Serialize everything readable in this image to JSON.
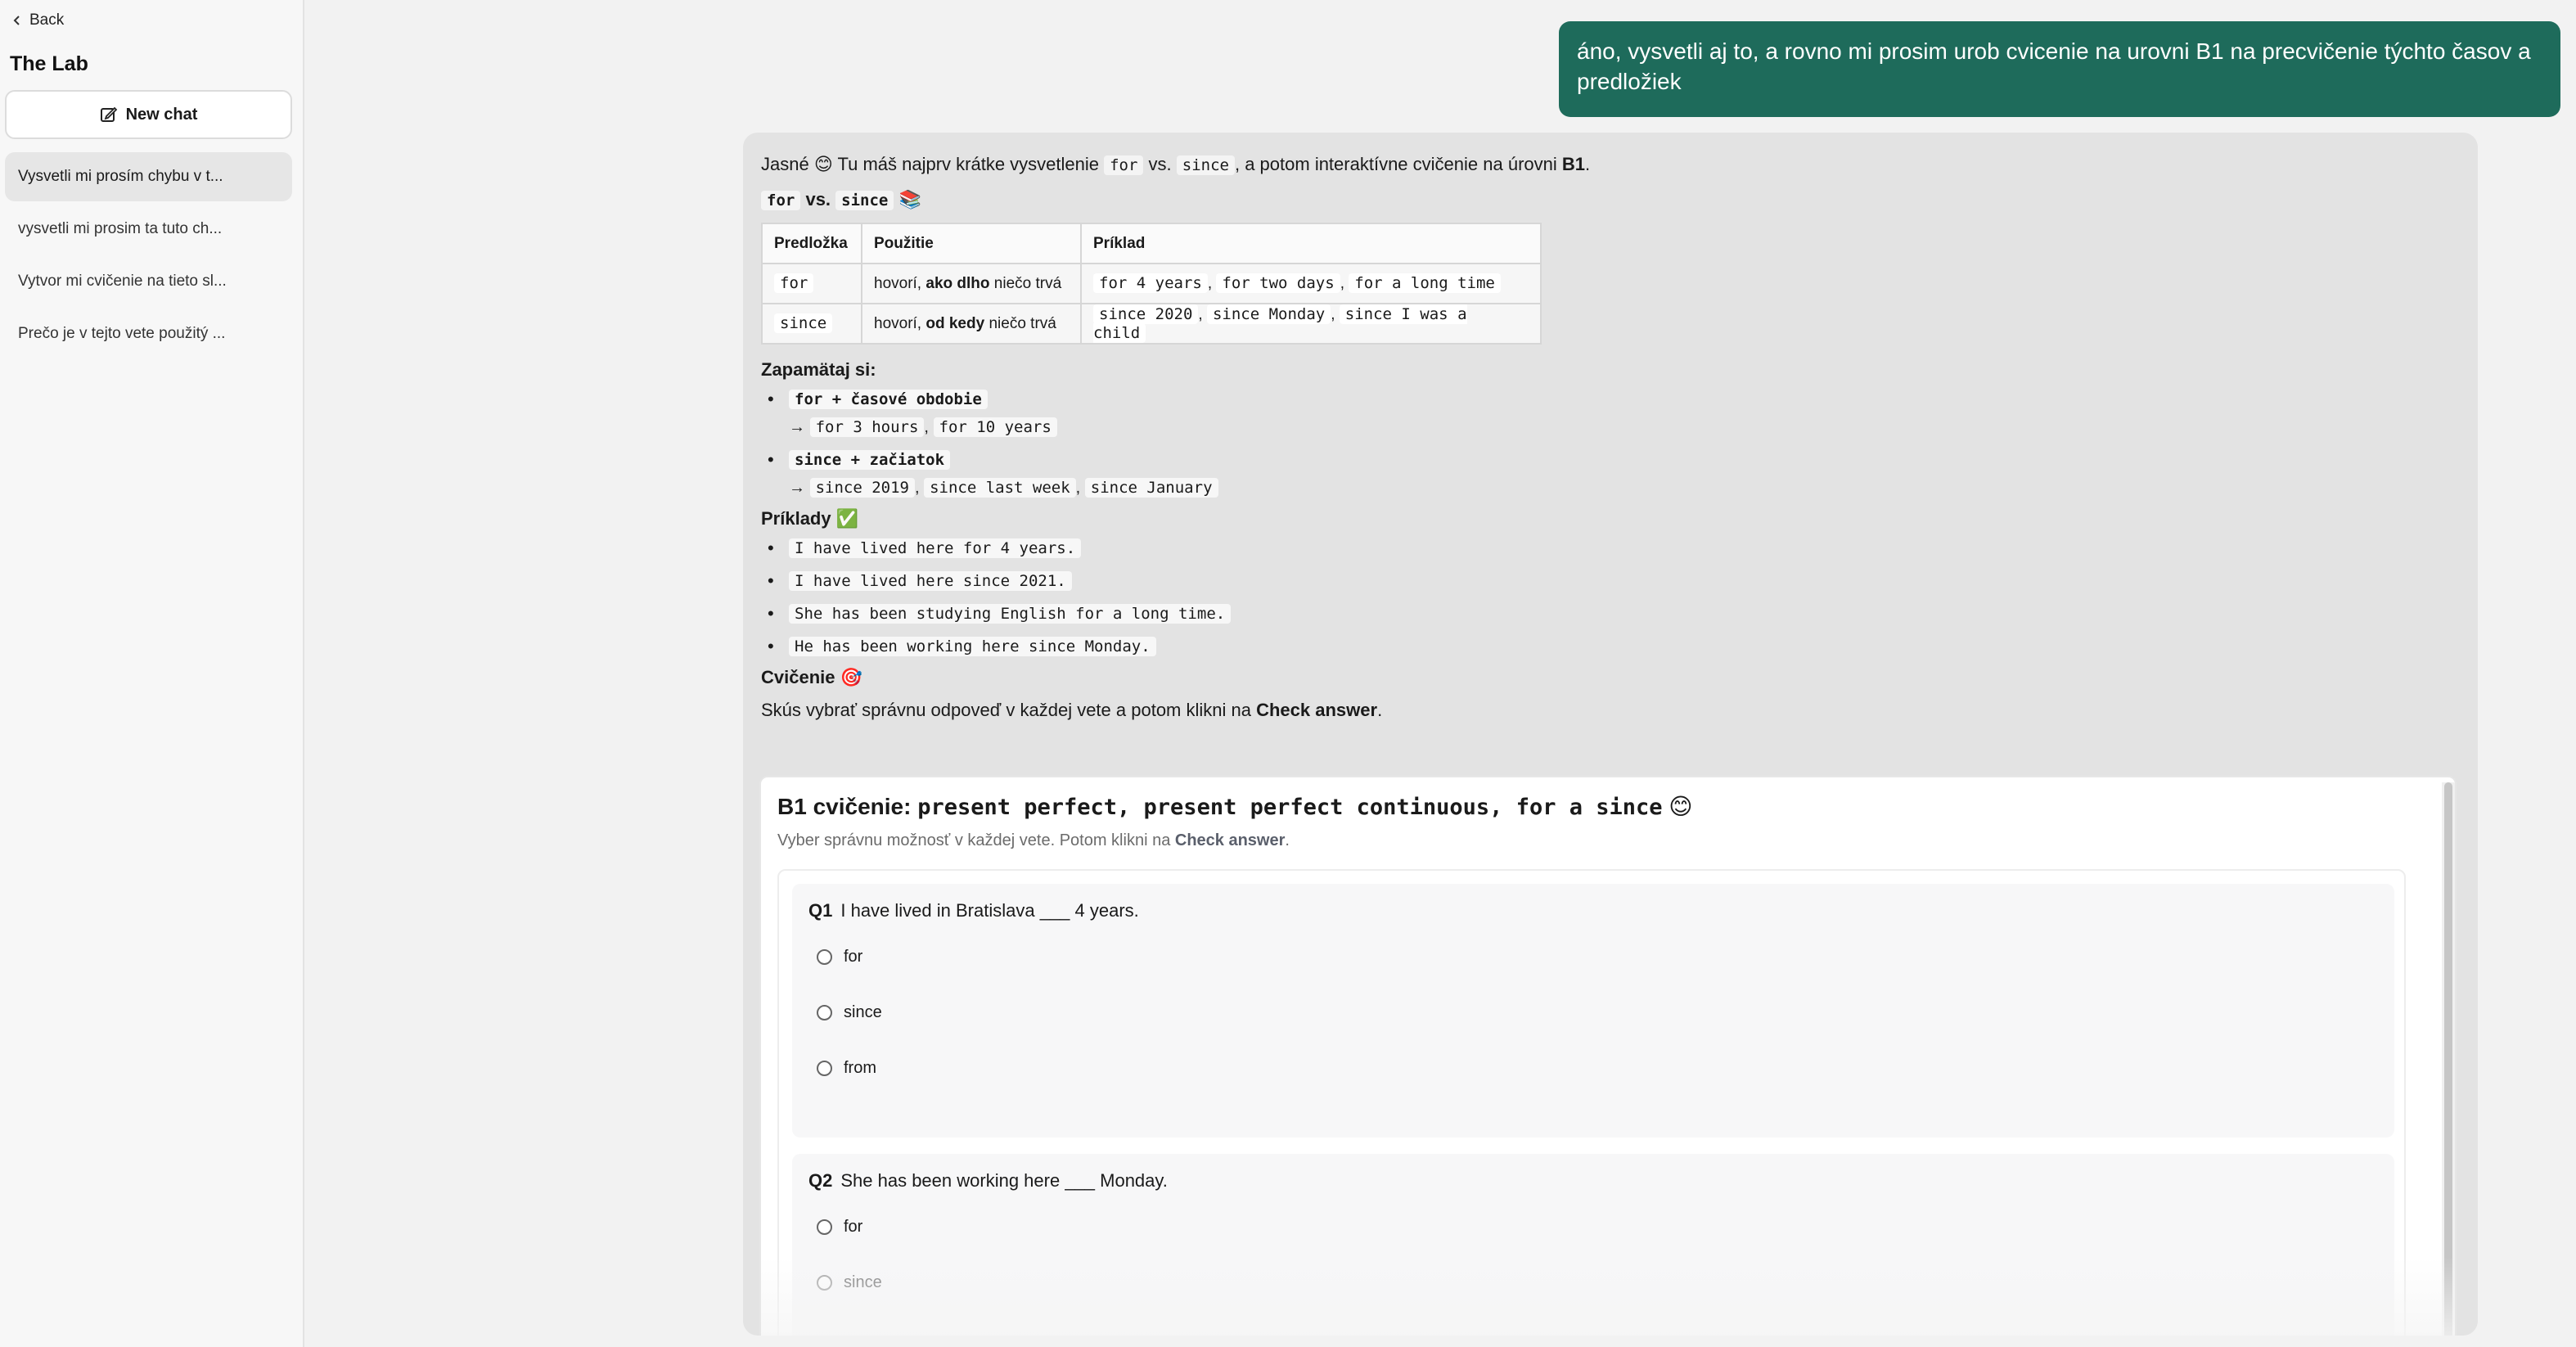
{
  "sidebar": {
    "back_label": "Back",
    "title": "The Lab",
    "new_chat_label": "New chat",
    "history": [
      {
        "label": "Vysvetli mi prosím chybu v t..."
      },
      {
        "label": "vysvetli mi prosim ta tuto ch..."
      },
      {
        "label": "Vytvor mi cvičenie na tieto sl..."
      },
      {
        "label": "Prečo je v tejto vete použitý ..."
      }
    ]
  },
  "user_message": "áno, vysvetli aj to, a rovno mi prosim urob cvicenie na urovni B1 na precvičenie týchto časov a predložiek",
  "assistant": {
    "intro_a": "Jasné 😊 Tu máš najprv krátke vysvetlenie ",
    "intro_for": "for",
    "intro_vs": " vs. ",
    "intro_since": "since",
    "intro_b": ", a potom interaktívne cvičenie na úrovni ",
    "intro_level": "B1",
    "intro_end": ".",
    "heading1_for": "for",
    "heading1_vs": "vs.",
    "heading1_since": "since",
    "heading1_emoji": "📚",
    "table": {
      "headers": [
        "Predložka",
        "Použitie",
        "Príklad"
      ],
      "rows": [
        {
          "prep": "for",
          "use_a": "hovorí, ",
          "use_b": "ako dlho",
          "use_c": " niečo trvá",
          "ex": [
            "for 4 years",
            "for two days",
            "for a long time"
          ]
        },
        {
          "prep": "since",
          "use_a": "hovorí, ",
          "use_b": "od kedy",
          "use_c": " niečo trvá",
          "ex": [
            "since 2020",
            "since Monday",
            "since I was a child"
          ]
        }
      ]
    },
    "remember_heading": "Zapamätaj si:",
    "remember": [
      {
        "rule": "for + časové obdobie",
        "arrow": "→",
        "ex": [
          "for 3 hours",
          "for 10 years"
        ]
      },
      {
        "rule": "since + začiatok",
        "arrow": "→",
        "ex": [
          "since 2019",
          "since last week",
          "since January"
        ]
      }
    ],
    "examples_heading": "Príklady",
    "examples_emoji": "✅",
    "examples": [
      "I have lived here for 4 years.",
      "I have lived here since 2021.",
      "She has been studying English for a long time.",
      "He has been working here since Monday."
    ],
    "exercise_heading": "Cvičenie",
    "exercise_emoji": "🎯",
    "instruction_a": "Skús vybrať správnu odpoveď v každej vete a potom klikni na ",
    "instruction_b": "Check answer",
    "instruction_c": "."
  },
  "exercise": {
    "title_a": "B1 cvičenie: ",
    "title_code": "present perfect, present perfect continuous, for a since",
    "title_emoji": "😊",
    "sub_a": "Vyber správnu možnosť v každej vete. Potom klikni na ",
    "sub_b": "Check answer",
    "sub_c": ".",
    "questions": [
      {
        "num": "Q1",
        "text": "I have lived in Bratislava ___ 4 years.",
        "options": [
          "for",
          "since",
          "from"
        ]
      },
      {
        "num": "Q2",
        "text": "She has been working here ___ Monday.",
        "options": [
          "for",
          "since"
        ]
      }
    ]
  }
}
